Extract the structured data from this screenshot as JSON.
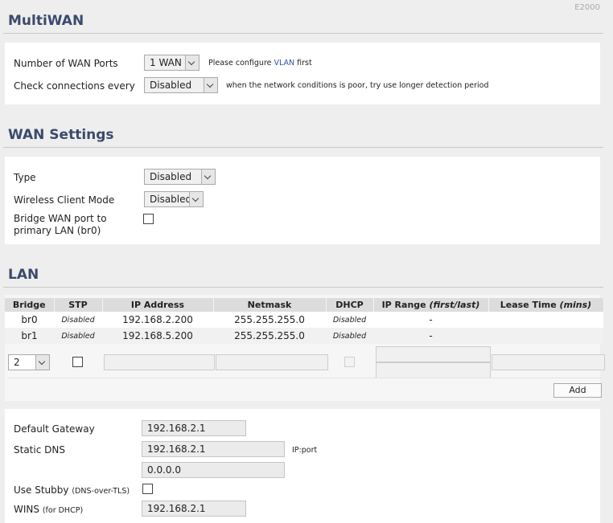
{
  "model": "E2000",
  "multiwan": {
    "title": "MultiWAN",
    "wan_ports_label": "Number of WAN Ports",
    "wan_ports_value": "1 WAN",
    "wan_ports_hint_prefix": "Please configure",
    "wan_ports_hint_link": "VLAN",
    "wan_ports_hint_suffix": "first",
    "check_label": "Check connections every",
    "check_value": "Disabled",
    "check_hint": "when the network conditions is poor, try use longer detection period"
  },
  "wan": {
    "title": "WAN Settings",
    "type_label": "Type",
    "type_value": "Disabled",
    "wireless_label": "Wireless Client Mode",
    "wireless_value": "Disabled",
    "bridge_label_line1": "Bridge WAN port to",
    "bridge_label_line2": "primary LAN (br0)"
  },
  "lan": {
    "title": "LAN",
    "headers": {
      "bridge": "Bridge",
      "stp": "STP",
      "ip": "IP Address",
      "netmask": "Netmask",
      "dhcp": "DHCP",
      "range": "IP Range",
      "range_em": "(first/last)",
      "lease": "Lease Time",
      "lease_em": "(mins)"
    },
    "rows": [
      {
        "bridge": "br0",
        "stp": "Disabled",
        "ip": "192.168.2.200",
        "netmask": "255.255.255.0",
        "dhcp": "Disabled",
        "range": "-",
        "lease": ""
      },
      {
        "bridge": "br1",
        "stp": "Disabled",
        "ip": "192.168.5.200",
        "netmask": "255.255.255.0",
        "dhcp": "Disabled",
        "range": "-",
        "lease": ""
      }
    ],
    "new_bridge_value": "2",
    "add_label": "Add"
  },
  "network": {
    "gateway_label": "Default Gateway",
    "gateway_value": "192.168.2.1",
    "dns_label": "Static DNS",
    "dns1_value": "192.168.2.1",
    "dns_hint": "IP:port",
    "dns2_value": "0.0.0.0",
    "stubby_label": "Use Stubby",
    "stubby_note": "(DNS-over-TLS)",
    "wins_label": "WINS",
    "wins_note": "(for DHCP)",
    "wins_value": "192.168.2.1"
  },
  "colors": {
    "title": "#3b4a6b",
    "link": "#2f55a4",
    "table_header": "#dcdcdc",
    "page_bg": "#eeeeee"
  }
}
